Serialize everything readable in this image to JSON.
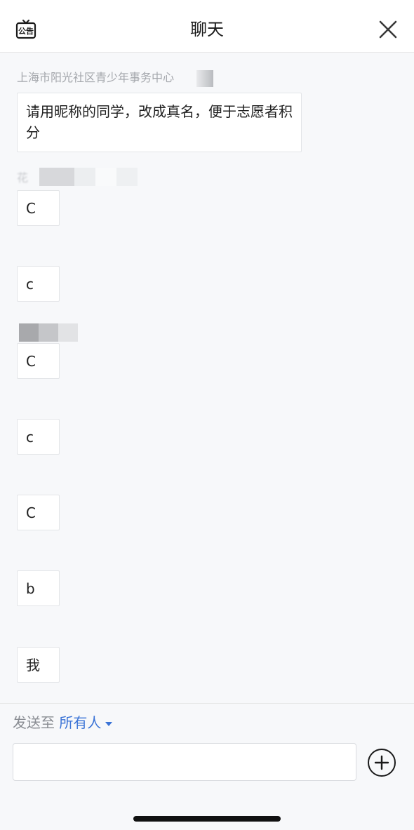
{
  "header": {
    "title": "聊天",
    "notice_icon": "notice-board-icon",
    "notice_icon_text": "公告",
    "close_icon": "close-icon"
  },
  "messages": [
    {
      "sender": "上海市阳光社区青少年事务中心",
      "text": "请用昵称的同学，改成真名，便于志愿者积分"
    },
    {
      "text": "C"
    },
    {
      "text": "c"
    },
    {
      "text": "C"
    },
    {
      "text": "c"
    },
    {
      "text": "C"
    },
    {
      "text": "b"
    },
    {
      "text": "我"
    }
  ],
  "footer": {
    "send_to_label": "发送至",
    "recipient": "所有人",
    "input_value": "",
    "add_icon": "plus-circle-icon"
  },
  "colors": {
    "background": "#f7f8fa",
    "accent": "#3a73d6",
    "sender_gray": "#a3a6ab"
  }
}
